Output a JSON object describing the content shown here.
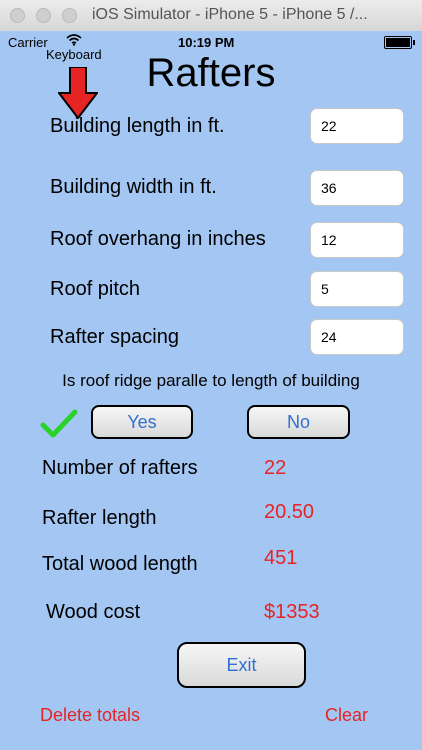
{
  "window": {
    "title": "iOS Simulator - iPhone 5 - iPhone 5 /..."
  },
  "statusbar": {
    "carrier": "Carrier",
    "time": "10:19 PM"
  },
  "annotation": {
    "keyboard_label": "Keyboard"
  },
  "app": {
    "title": "Rafters"
  },
  "fields": [
    {
      "label": "Building length in ft.",
      "value": "22"
    },
    {
      "label": "Building width in ft.",
      "value": "36"
    },
    {
      "label": "Roof overhang in inches",
      "value": "12"
    },
    {
      "label": "Roof pitch",
      "value": "5"
    },
    {
      "label": "Rafter spacing",
      "value": "24"
    }
  ],
  "ridge": {
    "question": "Is roof ridge paralle to length of building",
    "yes_label": "Yes",
    "no_label": "No"
  },
  "results": [
    {
      "label": "Number of rafters",
      "value": "22"
    },
    {
      "label": "Rafter length",
      "value": "20.50"
    },
    {
      "label": "Total wood length",
      "value": "451"
    },
    {
      "label": "Wood cost",
      "value": "$1353"
    }
  ],
  "actions": {
    "exit_label": "Exit",
    "delete_label": "Delete totals",
    "clear_label": "Clear"
  },
  "colors": {
    "background": "#a3c6f3",
    "accent_red": "#e62424",
    "button_text": "#2f6fd1",
    "check_green": "#2bd12b"
  }
}
